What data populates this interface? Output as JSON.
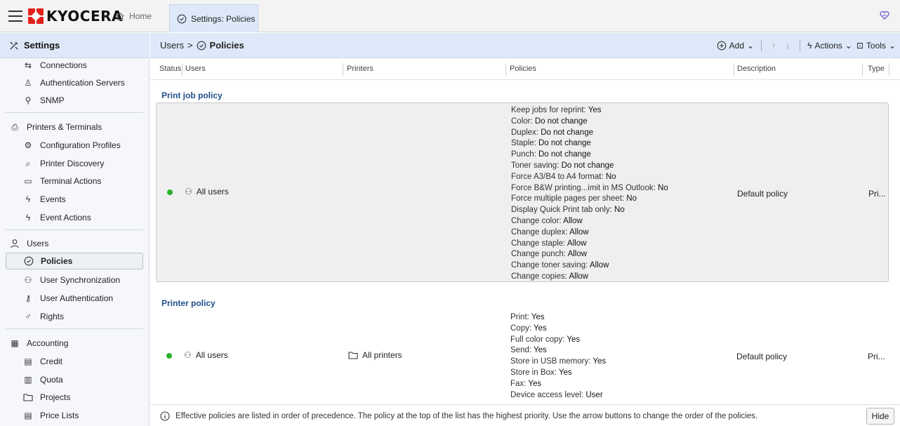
{
  "topbar": {
    "brand": "KYOCERA",
    "home_tab": "Home",
    "active_tab": "Settings: Policies"
  },
  "sidebar": {
    "title": "Settings",
    "items": [
      {
        "label": "Connections",
        "icon": "connections-icon"
      },
      {
        "label": "Authentication Servers",
        "icon": "auth-server-icon"
      },
      {
        "label": "SNMP",
        "icon": "snmp-icon"
      },
      {
        "label": "Printers & Terminals",
        "icon": "printer-icon"
      },
      {
        "label": "Configuration Profiles",
        "icon": "config-icon"
      },
      {
        "label": "Printer Discovery",
        "icon": "discovery-icon"
      },
      {
        "label": "Terminal Actions",
        "icon": "terminal-icon"
      },
      {
        "label": "Events",
        "icon": "events-icon"
      },
      {
        "label": "Event Actions",
        "icon": "event-actions-icon"
      },
      {
        "label": "Users",
        "icon": "user-icon"
      },
      {
        "label": "Policies",
        "icon": "policy-icon"
      },
      {
        "label": "User Synchronization",
        "icon": "user-sync-icon"
      },
      {
        "label": "User Authentication",
        "icon": "user-auth-icon"
      },
      {
        "label": "Rights",
        "icon": "rights-icon"
      },
      {
        "label": "Accounting",
        "icon": "accounting-icon"
      },
      {
        "label": "Credit",
        "icon": "credit-icon"
      },
      {
        "label": "Quota",
        "icon": "quota-icon"
      },
      {
        "label": "Projects",
        "icon": "projects-icon"
      },
      {
        "label": "Price Lists",
        "icon": "price-list-icon"
      }
    ]
  },
  "main": {
    "breadcrumb_parent": "Users",
    "breadcrumb_sep": ">",
    "breadcrumb_current": "Policies",
    "toolbar": {
      "add": "Add",
      "up": "↑",
      "down": "↓",
      "actions": "Actions",
      "tools": "Tools"
    },
    "columns": [
      "Status",
      "Users",
      "Printers",
      "Policies",
      "Description",
      "Type"
    ],
    "sections": [
      {
        "title": "Print job policy",
        "users": "All users",
        "printers": "",
        "description": "Default policy",
        "type": "Pri...",
        "policies": [
          {
            "k": "Keep jobs for reprint: ",
            "v": "Yes"
          },
          {
            "k": "Color: ",
            "v": "Do not change"
          },
          {
            "k": "Duplex: ",
            "v": "Do not change"
          },
          {
            "k": "Staple: ",
            "v": "Do not change"
          },
          {
            "k": "Punch: ",
            "v": "Do not change"
          },
          {
            "k": "Toner saving: ",
            "v": "Do not change"
          },
          {
            "k": "Force A3/B4 to A4 format: ",
            "v": "No"
          },
          {
            "k": "Force B&W printing...imit in MS Outlook: ",
            "v": "No"
          },
          {
            "k": "Force multiple pages per sheet: ",
            "v": "No"
          },
          {
            "k": "Display Quick Print tab only: ",
            "v": "No"
          },
          {
            "k": "Change color: ",
            "v": "Allow"
          },
          {
            "k": "Change duplex: ",
            "v": "Allow"
          },
          {
            "k": "Change staple: ",
            "v": "Allow"
          },
          {
            "k": "Change punch: ",
            "v": "Allow"
          },
          {
            "k": "Change toner saving: ",
            "v": "Allow"
          },
          {
            "k": "Change copies: ",
            "v": "Allow"
          }
        ]
      },
      {
        "title": "Printer policy",
        "users": "All users",
        "printers": "All printers",
        "description": "Default policy",
        "type": "Pri...",
        "policies": [
          {
            "k": "Print: ",
            "v": "Yes"
          },
          {
            "k": "Copy: ",
            "v": "Yes"
          },
          {
            "k": "Full color copy: ",
            "v": "Yes"
          },
          {
            "k": "Send: ",
            "v": "Yes"
          },
          {
            "k": "Store in USB memory: ",
            "v": "Yes"
          },
          {
            "k": "Store in Box: ",
            "v": "Yes"
          },
          {
            "k": "Fax: ",
            "v": "Yes"
          },
          {
            "k": "Device access level: ",
            "v": "User"
          }
        ]
      }
    ]
  },
  "footer": {
    "info": "Effective policies are listed in order of precedence. The policy at the top of the list has the highest priority. Use the arrow buttons to change the order of the policies.",
    "hide": "Hide"
  },
  "colors": {
    "accent": "#1f4e8c",
    "header_bg": "#dde9f8",
    "status_green": "#2ab02a",
    "brand_red": "#e5211b"
  }
}
